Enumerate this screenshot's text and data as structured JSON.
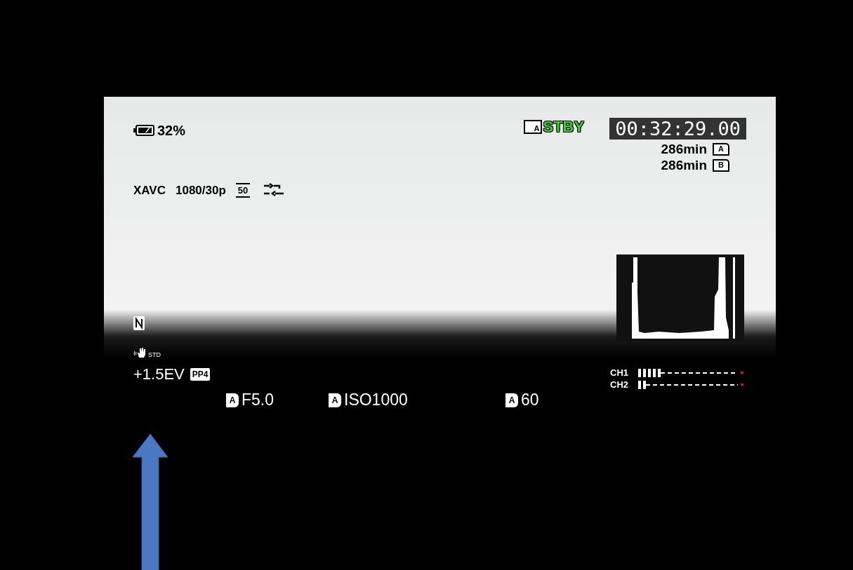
{
  "status": {
    "battery": "32%",
    "media_slot": "A",
    "record_state": "STBY",
    "timecode": "00:32:29.00"
  },
  "media": [
    {
      "remaining": "286min",
      "slot": "A"
    },
    {
      "remaining": "286min",
      "slot": "B"
    }
  ],
  "format": {
    "codec": "XAVC",
    "resolution": "1080/30p",
    "bitrate": "50"
  },
  "steadyshot": "STD",
  "exposure_comp": "+1.5EV",
  "picture_profile": "PP4",
  "exposure": [
    {
      "mode": "A",
      "value": "F5.0"
    },
    {
      "mode": "A",
      "value": "ISO1000"
    },
    {
      "mode": "A",
      "value": "60"
    }
  ],
  "audio": [
    {
      "label": "CH1",
      "level": 0.21
    },
    {
      "label": "CH2",
      "level": 0.07
    }
  ]
}
